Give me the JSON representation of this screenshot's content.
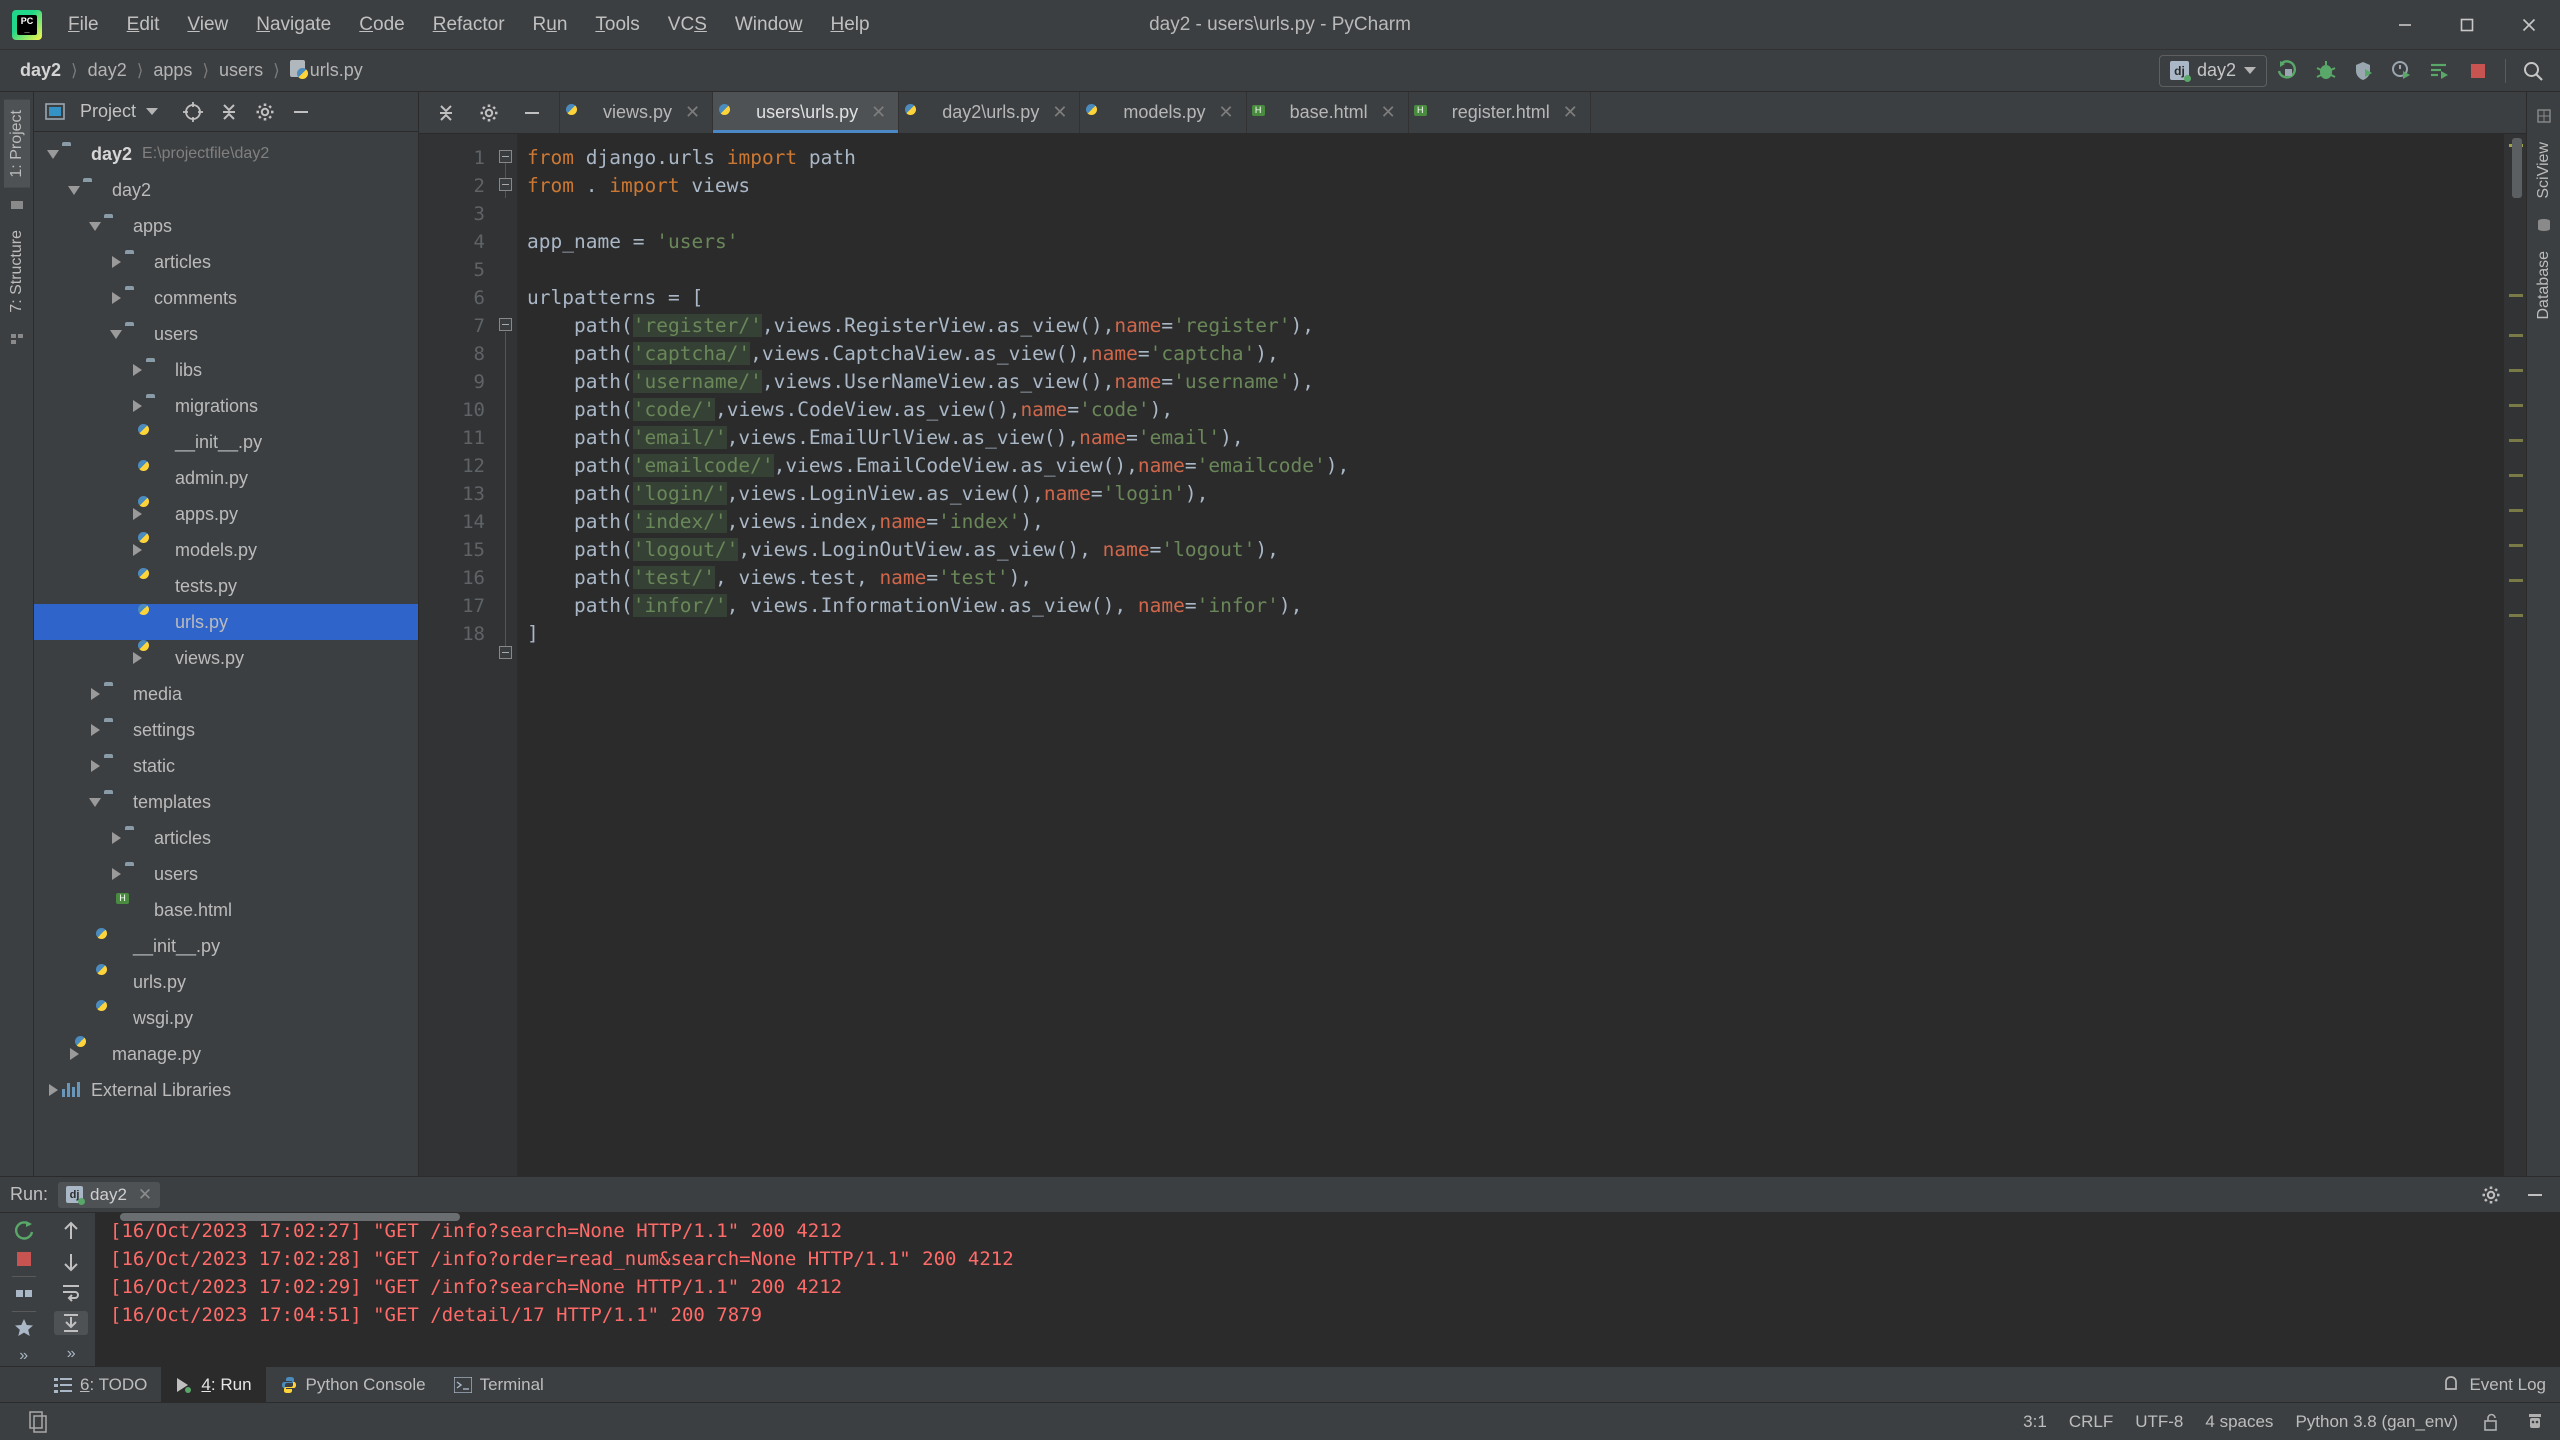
{
  "window": {
    "title": "day2 - users\\urls.py - PyCharm",
    "app_logo": "pycharm-logo",
    "minimize": "—",
    "maximize": "❐",
    "close": "✕"
  },
  "menubar": {
    "items": [
      {
        "label": "File",
        "mnemonic": "F"
      },
      {
        "label": "Edit",
        "mnemonic": "E"
      },
      {
        "label": "View",
        "mnemonic": "V"
      },
      {
        "label": "Navigate",
        "mnemonic": "N"
      },
      {
        "label": "Code",
        "mnemonic": "C"
      },
      {
        "label": "Refactor",
        "mnemonic": "R"
      },
      {
        "label": "Run",
        "mnemonic": "u"
      },
      {
        "label": "Tools",
        "mnemonic": "T"
      },
      {
        "label": "VCS",
        "mnemonic": "S"
      },
      {
        "label": "Window",
        "mnemonic": "W"
      },
      {
        "label": "Help",
        "mnemonic": "H"
      }
    ]
  },
  "breadcrumb": {
    "items": [
      "day2",
      "day2",
      "apps",
      "users",
      "urls.py"
    ],
    "separator": "〉",
    "file_icon": "python-file-icon"
  },
  "toolbar": {
    "run_config": "day2",
    "run_config_badge": "dj",
    "buttons": [
      {
        "name": "run-button",
        "icon": "run-icon"
      },
      {
        "name": "debug-button",
        "icon": "bug-icon"
      },
      {
        "name": "run-coverage-button",
        "icon": "coverage-icon"
      },
      {
        "name": "profile-button",
        "icon": "profile-icon"
      },
      {
        "name": "run-with-console-button",
        "icon": "run-list-icon"
      },
      {
        "name": "stop-button",
        "icon": "stop-icon"
      },
      {
        "name": "search-everywhere-button",
        "icon": "search-icon"
      }
    ]
  },
  "left_rail": {
    "tabs": [
      {
        "label": "1: Project",
        "active": true
      },
      {
        "label": "7: Structure",
        "active": false
      }
    ]
  },
  "right_rail": {
    "tabs": [
      {
        "label": "SciView"
      },
      {
        "label": "Database"
      }
    ]
  },
  "project_panel": {
    "title": "Project",
    "header_icons": [
      "chevron-collapse-icon",
      "target-icon",
      "gear-icon",
      "minimize-icon"
    ],
    "tree": [
      {
        "depth": 0,
        "label": "day2",
        "sub": "E:\\projectfile\\day2",
        "icon": "folder-root",
        "twisty": "down",
        "bold": true
      },
      {
        "depth": 1,
        "label": "day2",
        "sub": "",
        "icon": "folder-module",
        "twisty": "down"
      },
      {
        "depth": 2,
        "label": "apps",
        "sub": "",
        "icon": "folder-source",
        "twisty": "down"
      },
      {
        "depth": 3,
        "label": "articles",
        "sub": "",
        "icon": "folder-module",
        "twisty": "right"
      },
      {
        "depth": 3,
        "label": "comments",
        "sub": "",
        "icon": "folder-module",
        "twisty": "right"
      },
      {
        "depth": 3,
        "label": "users",
        "sub": "",
        "icon": "folder-module",
        "twisty": "down"
      },
      {
        "depth": 4,
        "label": "libs",
        "sub": "",
        "icon": "folder-module",
        "twisty": "right"
      },
      {
        "depth": 4,
        "label": "migrations",
        "sub": "",
        "icon": "folder-module",
        "twisty": "right"
      },
      {
        "depth": 4,
        "label": "__init__.py",
        "sub": "",
        "icon": "python-file",
        "twisty": "none"
      },
      {
        "depth": 4,
        "label": "admin.py",
        "sub": "",
        "icon": "python-file",
        "twisty": "none"
      },
      {
        "depth": 4,
        "label": "apps.py",
        "sub": "",
        "icon": "python-file",
        "twisty": "right"
      },
      {
        "depth": 4,
        "label": "models.py",
        "sub": "",
        "icon": "python-file",
        "twisty": "right"
      },
      {
        "depth": 4,
        "label": "tests.py",
        "sub": "",
        "icon": "python-file",
        "twisty": "none"
      },
      {
        "depth": 4,
        "label": "urls.py",
        "sub": "",
        "icon": "python-file",
        "twisty": "none",
        "selected": true
      },
      {
        "depth": 4,
        "label": "views.py",
        "sub": "",
        "icon": "python-file",
        "twisty": "right"
      },
      {
        "depth": 2,
        "label": "media",
        "sub": "",
        "icon": "folder-plain",
        "twisty": "right"
      },
      {
        "depth": 2,
        "label": "settings",
        "sub": "",
        "icon": "folder-module",
        "twisty": "right"
      },
      {
        "depth": 2,
        "label": "static",
        "sub": "",
        "icon": "folder-plain",
        "twisty": "right"
      },
      {
        "depth": 2,
        "label": "templates",
        "sub": "",
        "icon": "folder-templates",
        "twisty": "down"
      },
      {
        "depth": 3,
        "label": "articles",
        "sub": "",
        "icon": "folder-plain",
        "twisty": "right"
      },
      {
        "depth": 3,
        "label": "users",
        "sub": "",
        "icon": "folder-plain",
        "twisty": "right"
      },
      {
        "depth": 3,
        "label": "base.html",
        "sub": "",
        "icon": "html-file",
        "twisty": "none"
      },
      {
        "depth": 2,
        "label": "__init__.py",
        "sub": "",
        "icon": "python-file",
        "twisty": "none"
      },
      {
        "depth": 2,
        "label": "urls.py",
        "sub": "",
        "icon": "python-file",
        "twisty": "none"
      },
      {
        "depth": 2,
        "label": "wsgi.py",
        "sub": "",
        "icon": "python-file",
        "twisty": "none"
      },
      {
        "depth": 1,
        "label": "manage.py",
        "sub": "",
        "icon": "python-file",
        "twisty": "right"
      },
      {
        "depth": 0,
        "label": "External Libraries",
        "sub": "",
        "icon": "libraries",
        "twisty": "right"
      }
    ]
  },
  "editor": {
    "tabs": [
      {
        "label": "views.py",
        "icon": "python-file-icon",
        "active": false
      },
      {
        "label": "users\\urls.py",
        "icon": "python-file-icon",
        "active": true
      },
      {
        "label": "day2\\urls.py",
        "icon": "python-file-icon",
        "active": false
      },
      {
        "label": "models.py",
        "icon": "python-file-icon",
        "active": false
      },
      {
        "label": "base.html",
        "icon": "html-file-icon",
        "active": false
      },
      {
        "label": "register.html",
        "icon": "html-file-icon",
        "active": false
      }
    ],
    "line_numbers": [
      1,
      2,
      3,
      4,
      5,
      6,
      7,
      8,
      9,
      10,
      11,
      12,
      13,
      14,
      15,
      16,
      17,
      18
    ],
    "lines": [
      {
        "n": 1,
        "text": "from django.urls import path"
      },
      {
        "n": 2,
        "text": "from . import views"
      },
      {
        "n": 3,
        "text": ""
      },
      {
        "n": 4,
        "text": "app_name = 'users'"
      },
      {
        "n": 5,
        "text": ""
      },
      {
        "n": 6,
        "text": "urlpatterns = ["
      },
      {
        "n": 7,
        "text": "    path('register/',views.RegisterView.as_view(),name='register'),"
      },
      {
        "n": 8,
        "text": "    path('captcha/',views.CaptchaView.as_view(),name='captcha'),"
      },
      {
        "n": 9,
        "text": "    path('username/',views.UserNameView.as_view(),name='username'),"
      },
      {
        "n": 10,
        "text": "    path('code/',views.CodeView.as_view(),name='code'),"
      },
      {
        "n": 11,
        "text": "    path('email/',views.EmailUrlView.as_view(),name='email'),"
      },
      {
        "n": 12,
        "text": "    path('emailcode/',views.EmailCodeView.as_view(),name='emailcode'),"
      },
      {
        "n": 13,
        "text": "    path('login/',views.LoginView.as_view(),name='login'),"
      },
      {
        "n": 14,
        "text": "    path('index/',views.index,name='index'),"
      },
      {
        "n": 15,
        "text": "    path('logout/',views.LoginOutView.as_view(), name='logout'),"
      },
      {
        "n": 16,
        "text": "    path('test/', views.test, name='test'),"
      },
      {
        "n": 17,
        "text": "    path('infor/', views.InformationView.as_view(), name='infor'),"
      },
      {
        "n": 18,
        "text": "]"
      }
    ]
  },
  "run_panel": {
    "label": "Run:",
    "tab": "day2",
    "tab_icon": "django-icon",
    "close_icon": "✕",
    "settings_icon": "gear-icon",
    "minimize_icon": "minimize-icon",
    "tool_buttons": [
      {
        "name": "rerun-button",
        "icon": "rerun-icon"
      },
      {
        "name": "stop-button",
        "icon": "stop-square-icon"
      },
      {
        "name": "print-button",
        "icon": "print-icon"
      },
      {
        "name": "scroll-up-button",
        "icon": "arrow-up-icon"
      },
      {
        "name": "scroll-down-button",
        "icon": "arrow-down-icon"
      },
      {
        "name": "soft-wrap-button",
        "icon": "wrap-icon"
      },
      {
        "name": "scroll-to-end-button",
        "icon": "scroll-end-icon"
      }
    ],
    "output": [
      "[16/Oct/2023 17:02:27] \"GET /info?search=None HTTP/1.1\" 200 4212",
      "[16/Oct/2023 17:02:28] \"GET /info?order=read_num&search=None HTTP/1.1\" 200 4212",
      "[16/Oct/2023 17:02:29] \"GET /info?search=None HTTP/1.1\" 200 4212",
      "[16/Oct/2023 17:04:51] \"GET /detail/17 HTTP/1.1\" 200 7879"
    ]
  },
  "toolwindow_bar": {
    "items": [
      {
        "label": "6: TODO",
        "mnemonic": "6",
        "icon": "todo-icon",
        "active": false
      },
      {
        "label": "4: Run",
        "mnemonic": "4",
        "icon": "run-green-icon",
        "active": true
      },
      {
        "label": "Python Console",
        "mnemonic": "",
        "icon": "python-icon",
        "active": false
      },
      {
        "label": "Terminal",
        "mnemonic": "",
        "icon": "terminal-icon",
        "active": false
      }
    ],
    "event_log": "Event Log",
    "event_log_icon": "bell-icon"
  },
  "statusbar": {
    "left_icon": "copy-icon",
    "caret": "3:1",
    "line_separator": "CRLF",
    "encoding": "UTF-8",
    "indent": "4 spaces",
    "interpreter": "Python 3.8 (gan_env)",
    "lock_icon": "unlock-icon",
    "inspector_icon": "inspector-icon"
  },
  "colors": {
    "chrome": "#3c3f41",
    "editor_bg": "#2b2b2b",
    "gutter": "#313335",
    "accent": "#4a88c7",
    "selection": "#2f65ca",
    "keyword": "#cc7832",
    "string": "#6a8759",
    "default_text": "#a9b7c6",
    "named_arg": "#d0674b",
    "console_error": "#ff6b68",
    "search_highlight": "#344134",
    "green": "#59a869",
    "stop_red": "#c75450"
  }
}
